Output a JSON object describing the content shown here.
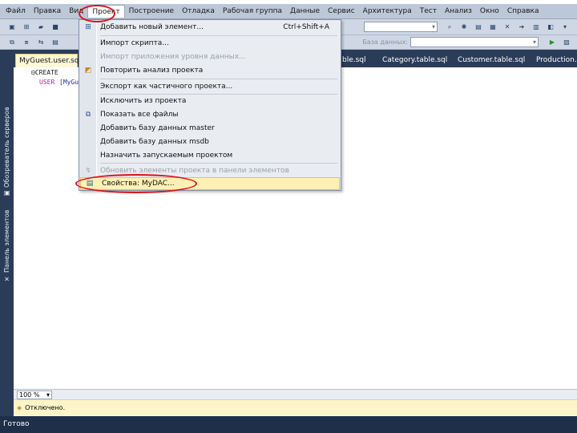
{
  "menu": [
    "Файл",
    "Правка",
    "Вид",
    "Проект",
    "Построение",
    "Отладка",
    "Рабочая группа",
    "Данные",
    "Сервис",
    "Архитектура",
    "Тест",
    "Анализ",
    "Окно",
    "Справка"
  ],
  "toolbar": {
    "db_label": "База данных:"
  },
  "left_panel": {
    "server_explorer": "Обозреватель серверов",
    "toolbox": "Панель элементов"
  },
  "tabs": [
    "MyGuest.user.sql",
    "Category.table.sql",
    "Customer.table.sql",
    "Production.s"
  ],
  "tab_partial": "ble.sql",
  "editor": {
    "line1": "⊟CREATE",
    "line2_kw": "USER",
    "line2_rest": "[MyGu"
  },
  "dropdown": {
    "items": [
      {
        "label": "Добавить новый элемент...",
        "shortcut": "Ctrl+Shift+A",
        "icon": "new-item"
      },
      {
        "label": "Импорт скрипта...",
        "shortcut": "",
        "icon": ""
      },
      {
        "label": "Импорт приложения уровня данных...",
        "shortcut": "",
        "icon": ""
      },
      {
        "label": "Повторить анализ проекта",
        "shortcut": "",
        "icon": "refresh"
      },
      {
        "label": "Экспорт как частичного проекта...",
        "shortcut": "",
        "icon": ""
      },
      {
        "label": "Исключить из проекта",
        "shortcut": "",
        "icon": ""
      },
      {
        "label": "Показать все файлы",
        "shortcut": "",
        "icon": "show-files"
      },
      {
        "label": "Добавить базу данных master",
        "shortcut": "",
        "icon": ""
      },
      {
        "label": "Добавить базу данных msdb",
        "shortcut": "",
        "icon": ""
      },
      {
        "label": "Назначить запускаемым проектом",
        "shortcut": "",
        "icon": ""
      },
      {
        "label": "Обновить элементы проекта в панели элементов",
        "shortcut": "",
        "icon": "update"
      },
      {
        "label": "Свойства: MyDAC...",
        "shortcut": "",
        "icon": "properties"
      }
    ]
  },
  "zoom": "100 %",
  "info": "Отключено.",
  "status": "Готово",
  "colors": {
    "menubar": "#bcc7d8",
    "dark_frame": "#2b3c59",
    "highlight": "#fff0b4",
    "annotation": "#d6141e"
  }
}
